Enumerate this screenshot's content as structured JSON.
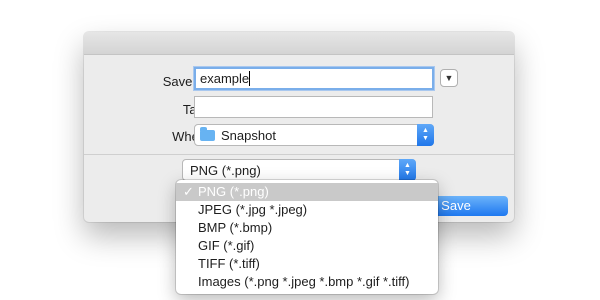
{
  "dialog": {
    "save_as_label": "Save As:",
    "save_as_value": "example",
    "tags_label": "Tags:",
    "tags_value": "",
    "where_label": "Where:",
    "where_value": "Snapshot",
    "format_value": "PNG (*.png)",
    "save_label": "Save",
    "expand_icon": "chevron-down-icon"
  },
  "format_menu": {
    "items": [
      {
        "label": "PNG (*.png)",
        "selected": true
      },
      {
        "label": "JPEG (*.jpg *.jpeg)"
      },
      {
        "label": "BMP (*.bmp)"
      },
      {
        "label": "GIF (*.gif)"
      },
      {
        "label": "TIFF (*.tiff)"
      },
      {
        "label": "Images (*.png *.jpeg *.bmp *.gif *.tiff)"
      }
    ],
    "check_mark": "✓"
  },
  "colors": {
    "accent": "#1e78f0",
    "dialog_bg": "#ececec",
    "focus_ring": "#7aaeea",
    "folder": "#67b3f2"
  }
}
